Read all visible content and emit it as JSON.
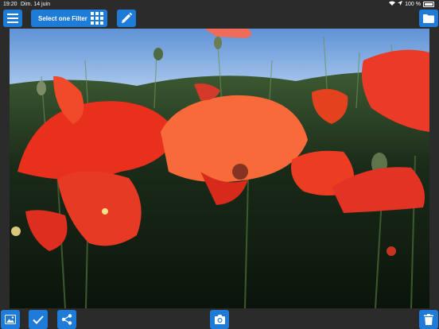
{
  "status_bar": {
    "time": "19:20",
    "date": "Dim. 14 juin",
    "battery": "100 %",
    "icons": [
      "wifi-icon",
      "location-icon",
      "battery-icon"
    ]
  },
  "top_toolbar": {
    "menu_icon": "hamburger-menu-icon",
    "filter_button_label": "Select one Filter",
    "filter_grid_icon": "grid-icon",
    "edit_icon": "pencil-icon",
    "folder_icon": "folder-icon"
  },
  "bottom_toolbar": {
    "icons": [
      "image-icon",
      "checkmark-icon",
      "share-icon",
      "camera-icon",
      "trash-icon"
    ]
  },
  "colors": {
    "accent": "#1f7bd8",
    "background": "#2b2b2b"
  }
}
